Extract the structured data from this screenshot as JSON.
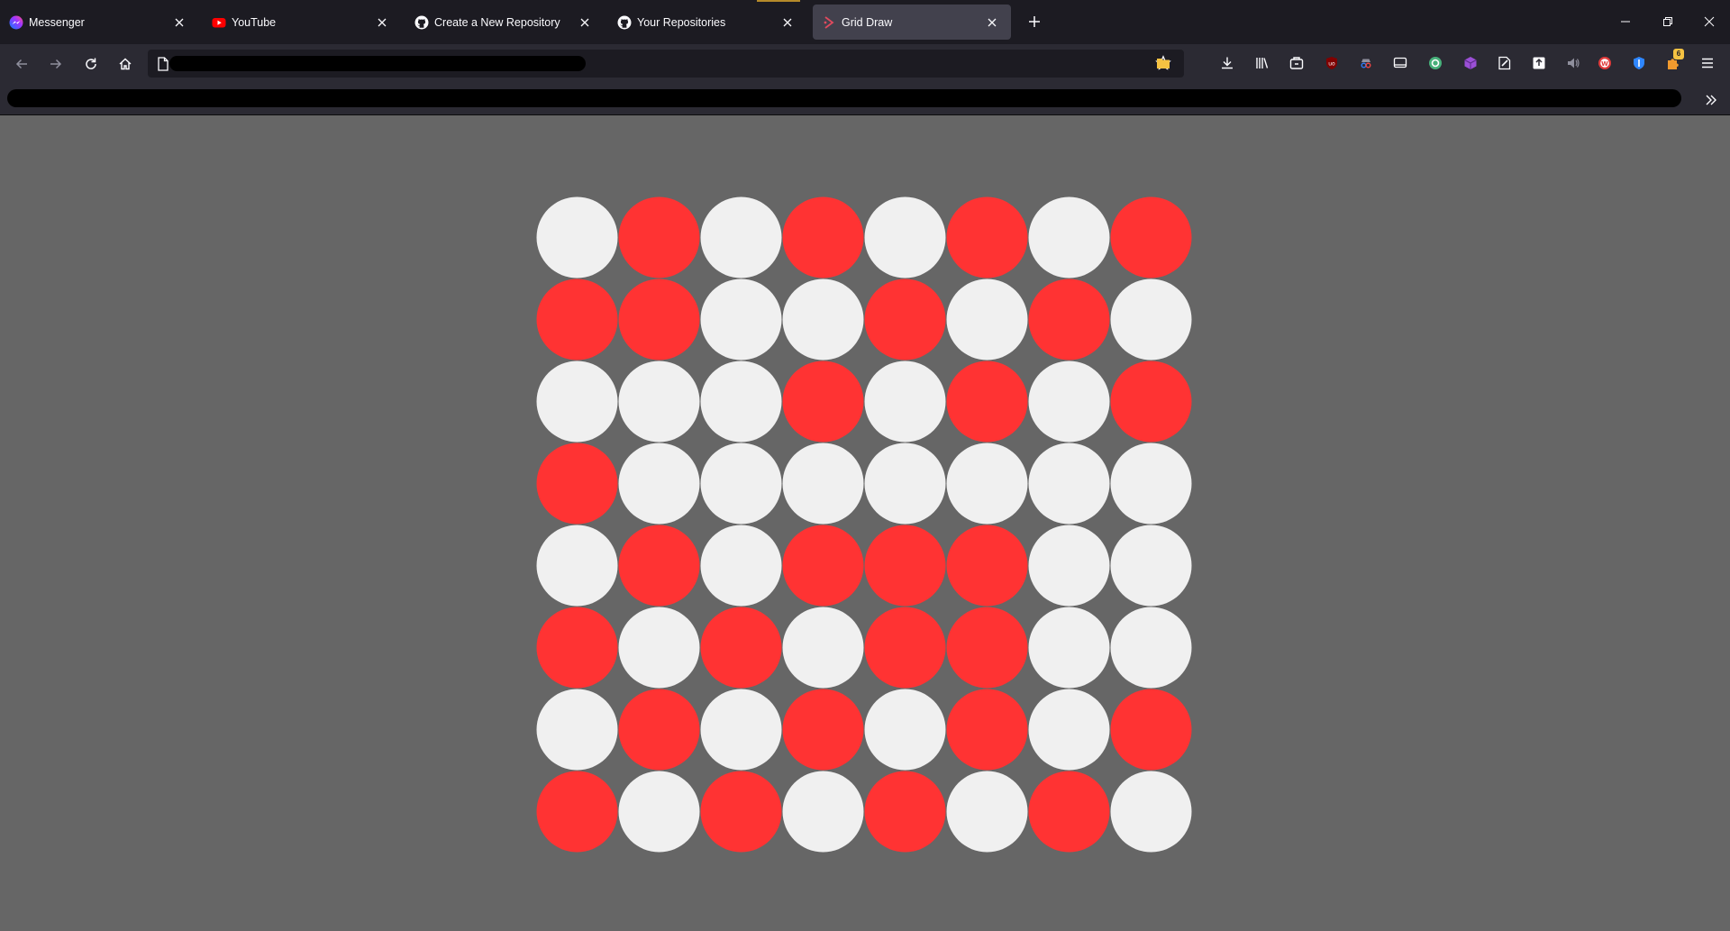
{
  "tabs": [
    {
      "title": "Messenger",
      "icon": "messenger-icon",
      "active": false
    },
    {
      "title": "YouTube",
      "icon": "youtube-icon",
      "active": false
    },
    {
      "title": "Create a New Repository",
      "icon": "github-icon",
      "active": false
    },
    {
      "title": "Your Repositories",
      "icon": "github-icon",
      "active": false
    },
    {
      "title": "Grid Draw",
      "icon": "grid-draw-icon",
      "active": true
    }
  ],
  "url": {
    "value": ""
  },
  "extensions": {
    "badge_count": "6"
  },
  "grid": {
    "rows": 8,
    "cols": 8,
    "colors": {
      "on": "#ff3333",
      "off": "#f0f0f0",
      "background": "#666666"
    },
    "cells": [
      [
        0,
        1,
        0,
        1,
        0,
        1,
        0,
        1
      ],
      [
        1,
        1,
        0,
        0,
        1,
        0,
        1,
        0
      ],
      [
        0,
        0,
        0,
        1,
        0,
        1,
        0,
        1
      ],
      [
        1,
        0,
        0,
        0,
        0,
        0,
        0,
        0
      ],
      [
        0,
        1,
        0,
        1,
        1,
        1,
        0,
        0
      ],
      [
        1,
        0,
        1,
        0,
        1,
        1,
        0,
        0
      ],
      [
        0,
        1,
        0,
        1,
        0,
        1,
        0,
        1
      ],
      [
        1,
        0,
        1,
        0,
        1,
        0,
        1,
        0
      ]
    ]
  }
}
